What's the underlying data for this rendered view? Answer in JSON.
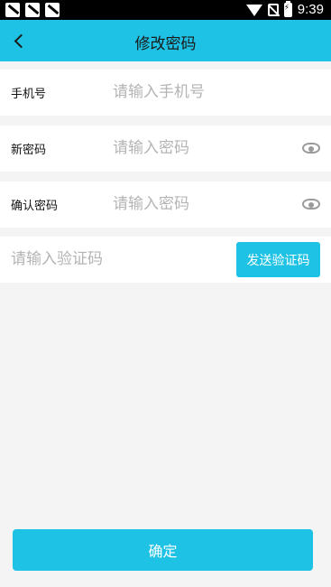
{
  "status_bar": {
    "time": "9:39",
    "icons": [
      "notification-icon",
      "notification-icon",
      "shopping-bag-icon",
      "wifi-icon",
      "no-sim-icon",
      "battery-charging-icon"
    ]
  },
  "header": {
    "title": "修改密码",
    "back_icon": "chevron-left-icon"
  },
  "form": {
    "phone": {
      "label": "手机号",
      "placeholder": "请输入手机号",
      "value": ""
    },
    "new_password": {
      "label": "新密码",
      "placeholder": "请输入密码",
      "value": "",
      "toggle_icon": "eye-icon"
    },
    "confirm_password": {
      "label": "确认密码",
      "placeholder": "请输入密码",
      "value": "",
      "toggle_icon": "eye-icon"
    },
    "verification": {
      "placeholder": "请输入验证码",
      "value": "",
      "send_label": "发送验证码"
    }
  },
  "actions": {
    "confirm_label": "确定"
  },
  "colors": {
    "accent": "#1ec2e4",
    "background": "#f4f4f4",
    "placeholder": "#b4b4b4"
  }
}
